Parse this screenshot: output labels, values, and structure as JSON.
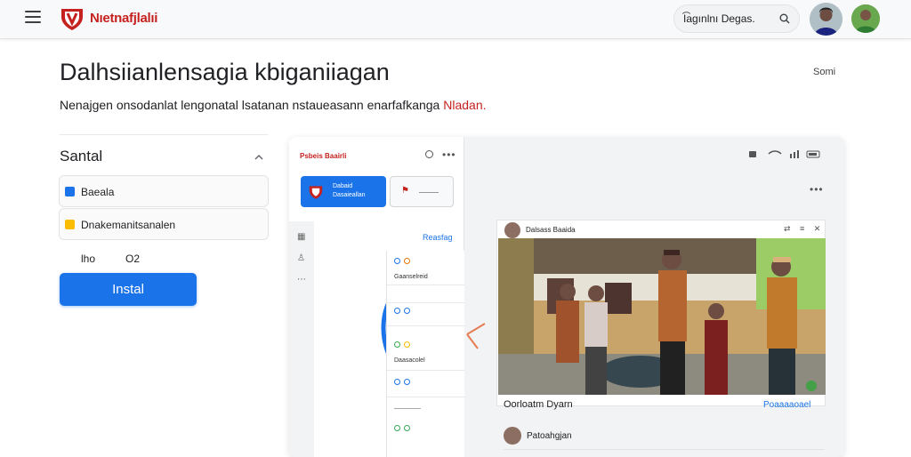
{
  "header": {
    "brand": "Nıetnafjlalıi",
    "search_value": "I͡agınlnı Degas.",
    "menu_icon": "hamburger-icon",
    "search_icon": "search-icon"
  },
  "main": {
    "title": "Dalhsiianlensagia kbiganiiagan",
    "menu_link": "Somi",
    "subtitle": "Nenajgen onsodanlat lengonatal lsatanan nstaueasann enarfafkanga ",
    "subtitle_highlight": "Nladan."
  },
  "left_panel": {
    "section_title": "Santal",
    "options": [
      {
        "label": "Baeala",
        "color": "#1a73e8"
      },
      {
        "label": "Dnakemanitsanalen",
        "color": "#f4b400"
      }
    ],
    "meta_left": "lho",
    "meta_right": "O2",
    "install_label": "Instal"
  },
  "preview": {
    "tag": "Psbeis Baairli",
    "primary_line1": "Dabaid",
    "primary_line2": "Dasaieallan",
    "section_link": "Reasfag",
    "list_items": [
      "Gaanselreid",
      "Daasacolel"
    ],
    "card": {
      "author": "Dalsass Baaida",
      "caption": "Oorloatm Dyarn",
      "link": "Poaaaaoael",
      "comment_author": "Patoahgjan"
    }
  },
  "colors": {
    "accent": "#1a73e8",
    "brand": "#c5221f"
  }
}
